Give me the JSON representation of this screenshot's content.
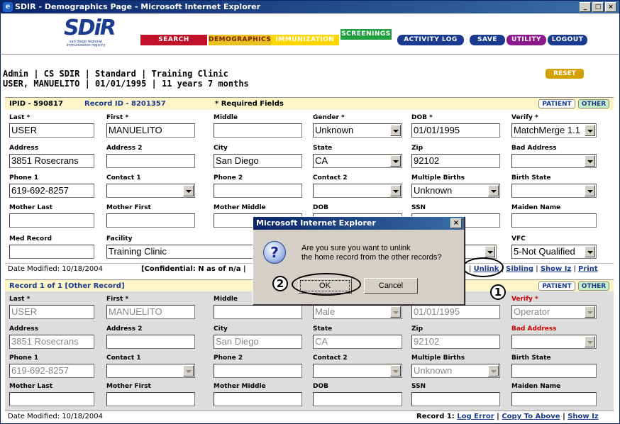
{
  "window": {
    "title": "SDIR - Demographics Page - Microsoft Internet Explorer"
  },
  "logo": {
    "text": "SDiR",
    "subtext": "san diego regional immunization registry"
  },
  "nav": {
    "search": "SEARCH",
    "demographics": "DEMOGRAPHICS",
    "immunization": "IMMUNIZATION",
    "screenings": "SCREENINGS",
    "activity_log": "ACTIVITY LOG",
    "save": "SAVE",
    "utility": "UTILITY",
    "logout": "LOGOUT"
  },
  "user": {
    "line1": "Admin | CS SDIR | Standard | Training Clinic",
    "line2": "USER, MANUELITO | 01/01/1995 | 11 years 7 months",
    "reset": "RESET"
  },
  "patient_header": {
    "ipid": "IPID - 590817",
    "record_id": "Record ID - 8201357",
    "required": "* Required Fields",
    "tab_patient": "PATIENT",
    "tab_other": "OTHER"
  },
  "patient": {
    "labels": {
      "last": "Last *",
      "first": "First *",
      "middle": "Middle",
      "gender": "Gender *",
      "dob": "DOB *",
      "verify": "Verify *",
      "address": "Address",
      "address2": "Address 2",
      "city": "City",
      "state": "State",
      "zip": "Zip",
      "bad_address": "Bad Address",
      "phone1": "Phone 1",
      "contact1": "Contact 1",
      "phone2": "Phone 2",
      "contact2": "Contact 2",
      "multiple_births": "Multiple Births",
      "birth_state": "Birth State",
      "mother_last": "Mother Last",
      "mother_first": "Mother First",
      "mother_middle": "Mother Middle",
      "mother_dob": "DOB",
      "ssn": "SSN",
      "maiden_name": "Maiden Name",
      "med_record": "Med Record",
      "facility": "Facility",
      "vfc": "VFC"
    },
    "values": {
      "last": "USER",
      "first": "MANUELITO",
      "middle": "",
      "gender": "Unknown",
      "dob": "01/01/1995",
      "verify": "MatchMerge 1.1",
      "address": "3851 Rosecrans",
      "address2": "",
      "city": "San Diego",
      "state": "CA",
      "zip": "92102",
      "bad_address": "",
      "phone1": "619-692-8257",
      "contact1": "",
      "phone2": "",
      "contact2": "",
      "multiple_births": "Unknown",
      "birth_state": "",
      "med_record": "",
      "facility": "Training Clinic",
      "vfc": "5-Not Qualified"
    },
    "date_modified": "Date Modified: 10/18/2004",
    "confidential": "[Confidential: N as of n/a |",
    "links": {
      "unlink": "Unlink",
      "sibling": "Sibling",
      "show_iz": "Show Iz",
      "print": "Print"
    }
  },
  "other_header": {
    "title": "Record 1 of 1 [Other Record]",
    "tab_patient": "PATIENT",
    "tab_other": "OTHER"
  },
  "other": {
    "labels": {
      "last": "Last *",
      "first": "First *",
      "middle": "Middle",
      "verify": "Verify *",
      "address": "Address",
      "address2": "Address 2",
      "city": "City",
      "state": "State",
      "zip": "Zip",
      "bad_address": "Bad Address",
      "phone1": "Phone 1",
      "contact1": "Contact 1",
      "phone2": "Phone 2",
      "contact2": "Contact 2",
      "multiple_births": "Multiple Births",
      "birth_state": "Birth State",
      "mother_last": "Mother Last",
      "mother_first": "Mother First",
      "mother_middle": "Mother Middle",
      "mother_dob": "DOB",
      "ssn": "SSN",
      "maiden_name": "Maiden Name"
    },
    "values": {
      "last": "USER",
      "first": "MANUELITO",
      "gender": "Male",
      "dob": "01/01/1995",
      "verify": "Operator",
      "address": "3851 Rosecrans",
      "city": "San Diego",
      "state": "CA",
      "zip": "92102",
      "phone1": "619-692-8257",
      "multiple_births": "Unknown"
    },
    "date_modified": "Date Modified: 10/18/2004",
    "record_label": "Record 1:",
    "links": {
      "log_error": "Log Error",
      "copy_to_above": "Copy To Above",
      "show_iz": "Show Iz"
    }
  },
  "dialog": {
    "title": "Microsoft Internet Explorer",
    "message_line1": "Are you sure you want to unlink",
    "message_line2": "the home record from the other records?",
    "ok": "OK",
    "cancel": "Cancel"
  },
  "callouts": {
    "one": "1",
    "two": "2"
  }
}
